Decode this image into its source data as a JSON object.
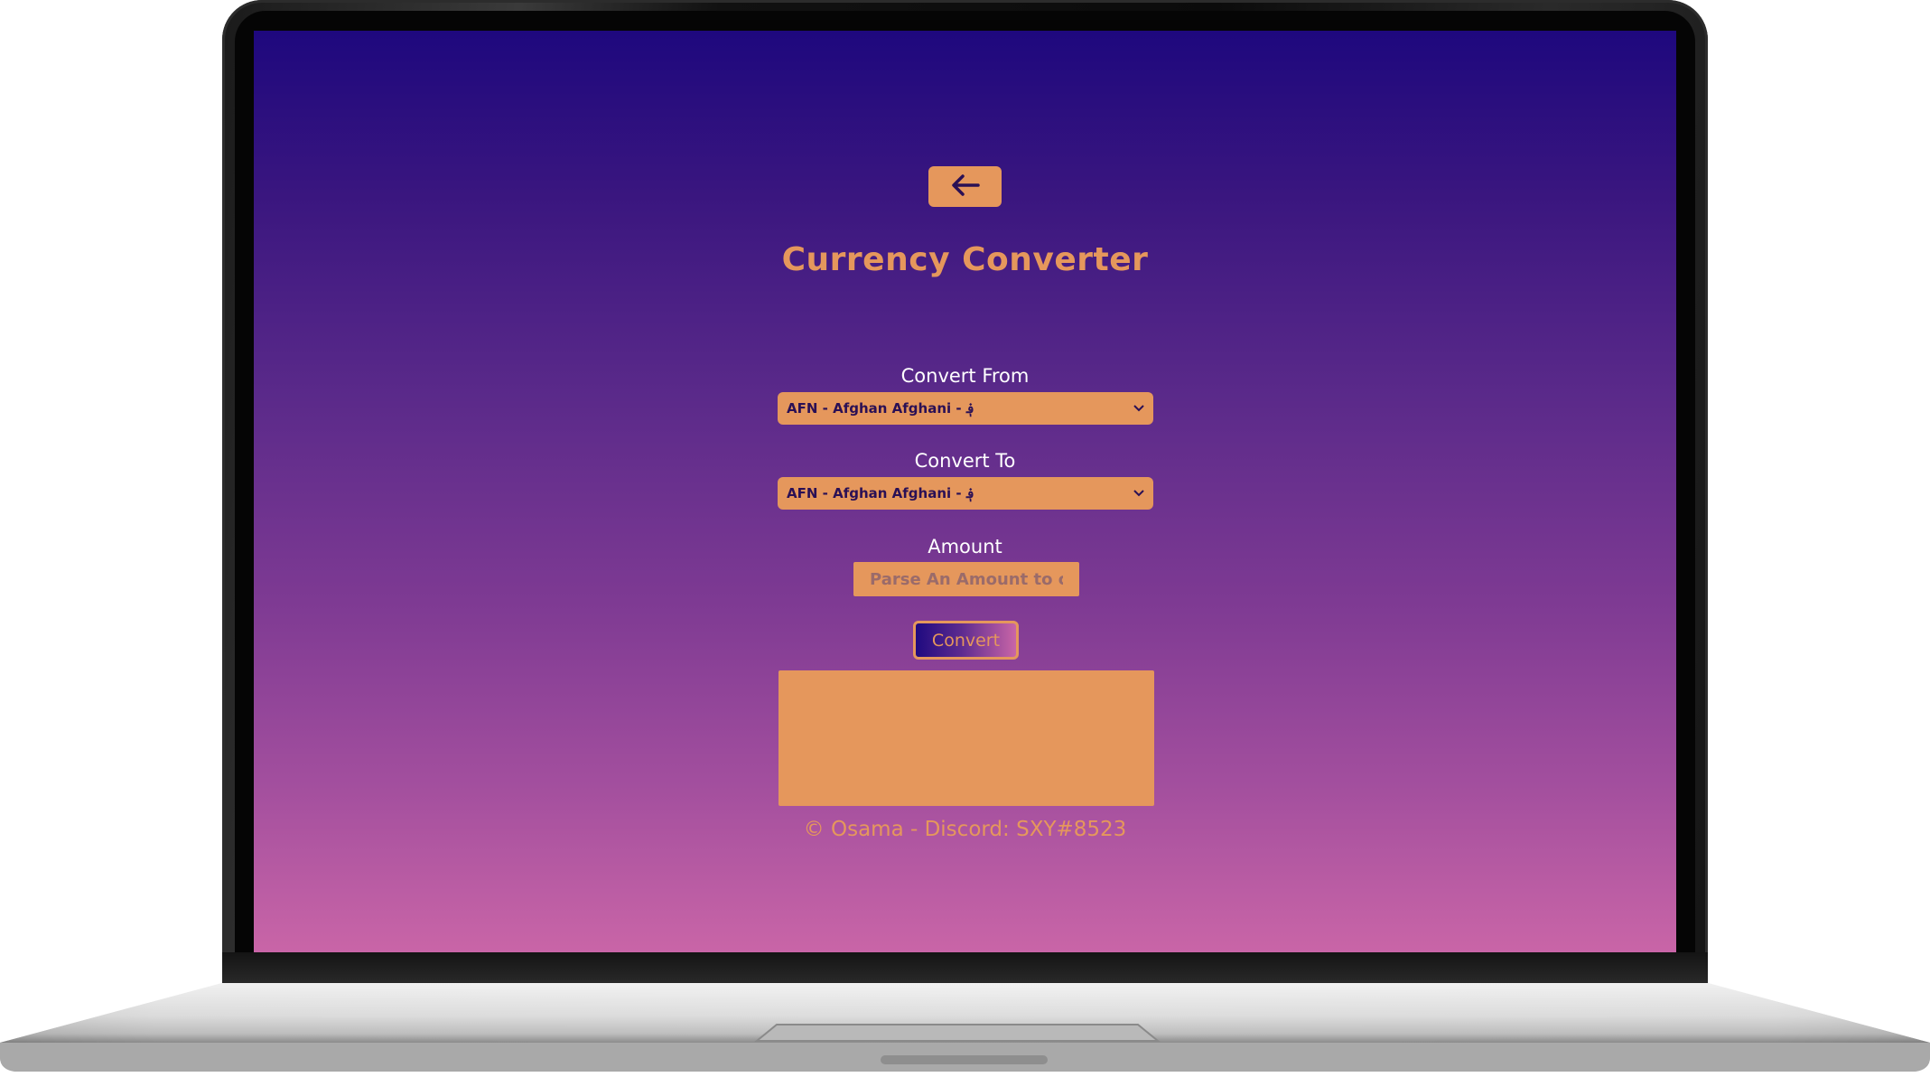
{
  "app": {
    "title": "Currency Converter",
    "back_icon": "arrow-left-icon",
    "convert_from": {
      "label": "Convert From",
      "selected": "AFN - Afghan Afghani - ؋"
    },
    "convert_to": {
      "label": "Convert To",
      "selected": "AFN - Afghan Afghani - ؋"
    },
    "amount": {
      "label": "Amount",
      "placeholder": "Parse An Amount to convert",
      "value": ""
    },
    "convert_label": "Convert",
    "result": "",
    "footer": "© Osama - Discord: SXY#8523"
  },
  "colors": {
    "accent": "#e5975c",
    "gradient_top": "#1e087e",
    "gradient_bottom": "#c965a7",
    "text_light": "#ffffff",
    "text_dark": "#2a1055"
  }
}
